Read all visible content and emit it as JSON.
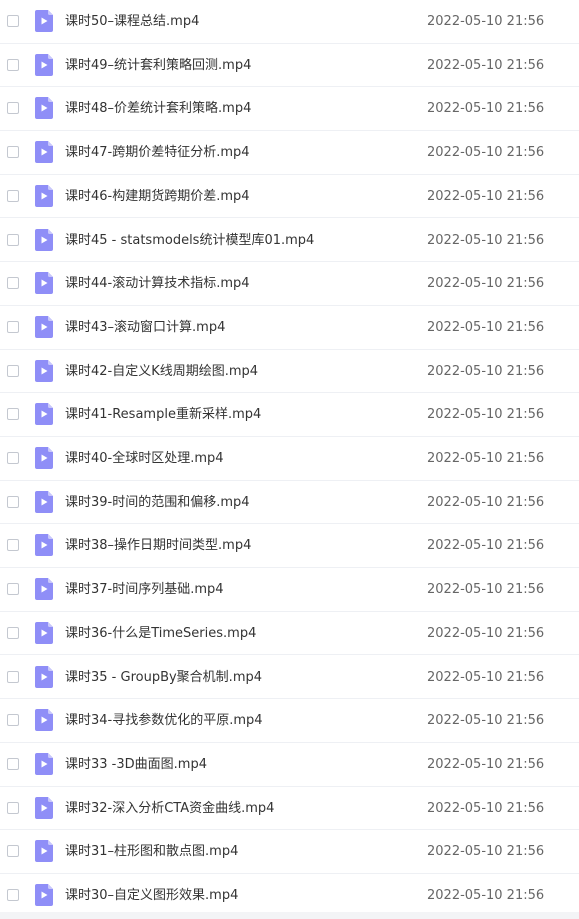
{
  "files": [
    {
      "name": "课时50–课程总结.mp4",
      "date": "2022-05-10 21:56",
      "icon": "video-file-icon"
    },
    {
      "name": "课时49–统计套利策略回测.mp4",
      "date": "2022-05-10 21:56",
      "icon": "video-file-icon"
    },
    {
      "name": "课时48–价差统计套利策略.mp4",
      "date": "2022-05-10 21:56",
      "icon": "video-file-icon"
    },
    {
      "name": "课时47-跨期价差特征分析.mp4",
      "date": "2022-05-10 21:56",
      "icon": "video-file-icon"
    },
    {
      "name": "课时46-构建期货跨期价差.mp4",
      "date": "2022-05-10 21:56",
      "icon": "video-file-icon"
    },
    {
      "name": "课时45 - statsmodels统计模型库01.mp4",
      "date": "2022-05-10 21:56",
      "icon": "video-file-icon"
    },
    {
      "name": "课时44-滚动计算技术指标.mp4",
      "date": "2022-05-10 21:56",
      "icon": "video-file-icon"
    },
    {
      "name": "课时43–滚动窗口计算.mp4",
      "date": "2022-05-10 21:56",
      "icon": "video-file-icon"
    },
    {
      "name": "课时42-自定义K线周期绘图.mp4",
      "date": "2022-05-10 21:56",
      "icon": "video-file-icon"
    },
    {
      "name": "课时41-Resample重新采样.mp4",
      "date": "2022-05-10 21:56",
      "icon": "video-file-icon"
    },
    {
      "name": "课时40-全球时区处理.mp4",
      "date": "2022-05-10 21:56",
      "icon": "video-file-icon"
    },
    {
      "name": "课时39-时间的范围和偏移.mp4",
      "date": "2022-05-10 21:56",
      "icon": "video-file-icon"
    },
    {
      "name": "课时38–操作日期时间类型.mp4",
      "date": "2022-05-10 21:56",
      "icon": "video-file-icon"
    },
    {
      "name": "课时37-时间序列基础.mp4",
      "date": "2022-05-10 21:56",
      "icon": "video-file-icon"
    },
    {
      "name": "课时36-什么是TimeSeries.mp4",
      "date": "2022-05-10 21:56",
      "icon": "video-file-icon"
    },
    {
      "name": "课时35 - GroupBy聚合机制.mp4",
      "date": "2022-05-10 21:56",
      "icon": "video-file-icon"
    },
    {
      "name": "课时34-寻找参数优化的平原.mp4",
      "date": "2022-05-10 21:56",
      "icon": "video-file-icon"
    },
    {
      "name": "课时33 -3D曲面图.mp4",
      "date": "2022-05-10 21:56",
      "icon": "video-file-icon"
    },
    {
      "name": "课时32-深入分析CTA资金曲线.mp4",
      "date": "2022-05-10 21:56",
      "icon": "video-file-icon"
    },
    {
      "name": "课时31–柱形图和散点图.mp4",
      "date": "2022-05-10 21:56",
      "icon": "video-file-icon"
    },
    {
      "name": "课时30–自定义图形效果.mp4",
      "date": "2022-05-10 21:56",
      "icon": "video-file-icon"
    }
  ],
  "colors": {
    "icon_fill": "#8f8ef7",
    "icon_fold": "#c9c8fb",
    "row_divider": "#eef0f4",
    "name_text": "#333333",
    "date_text": "#666666"
  }
}
